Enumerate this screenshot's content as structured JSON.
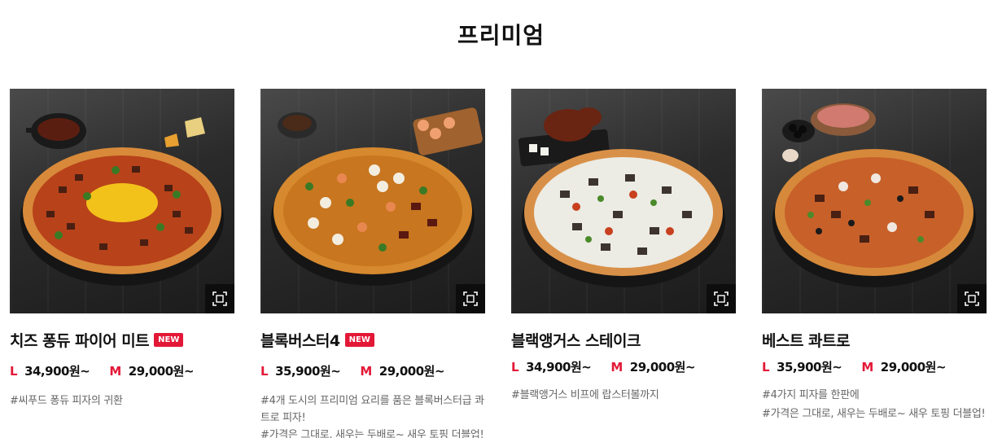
{
  "section": {
    "title": "프리미엄"
  },
  "products": [
    {
      "name": "치즈 퐁듀 파이어 미트",
      "badge": "NEW",
      "price_l_label": "L",
      "price_l": "34,900원~",
      "price_m_label": "M",
      "price_m": "29,000원~",
      "desc": [
        "#씨푸드 퐁듀 피자의 귀환"
      ]
    },
    {
      "name": "블록버스터4",
      "badge": "NEW",
      "price_l_label": "L",
      "price_l": "35,900원~",
      "price_m_label": "M",
      "price_m": "29,000원~",
      "desc": [
        "#4개 도시의 프리미엄 요리를 품은 블록버스터급 콰",
        "트로 피자!",
        "#가격은 그대로, 새우는 두배로~ 새우 토핑 더블업!"
      ]
    },
    {
      "name": "블랙앵거스 스테이크",
      "badge": "",
      "price_l_label": "L",
      "price_l": "34,900원~",
      "price_m_label": "M",
      "price_m": "29,000원~",
      "desc": [
        "#블랙앵거스 비프에 랍스터볼까지"
      ]
    },
    {
      "name": "베스트 콰트로",
      "badge": "",
      "price_l_label": "L",
      "price_l": "35,900원~",
      "price_m_label": "M",
      "price_m": "29,000원~",
      "desc": [
        "#4가지 피자를 한판에",
        "#가격은 그대로, 새우는 두배로~ 새우 토핑 더블업!"
      ]
    }
  ],
  "icons": {
    "zoom": "expand-frame-icon"
  },
  "colors": {
    "accent": "#e31837",
    "text": "#111111",
    "desc": "#666666"
  }
}
